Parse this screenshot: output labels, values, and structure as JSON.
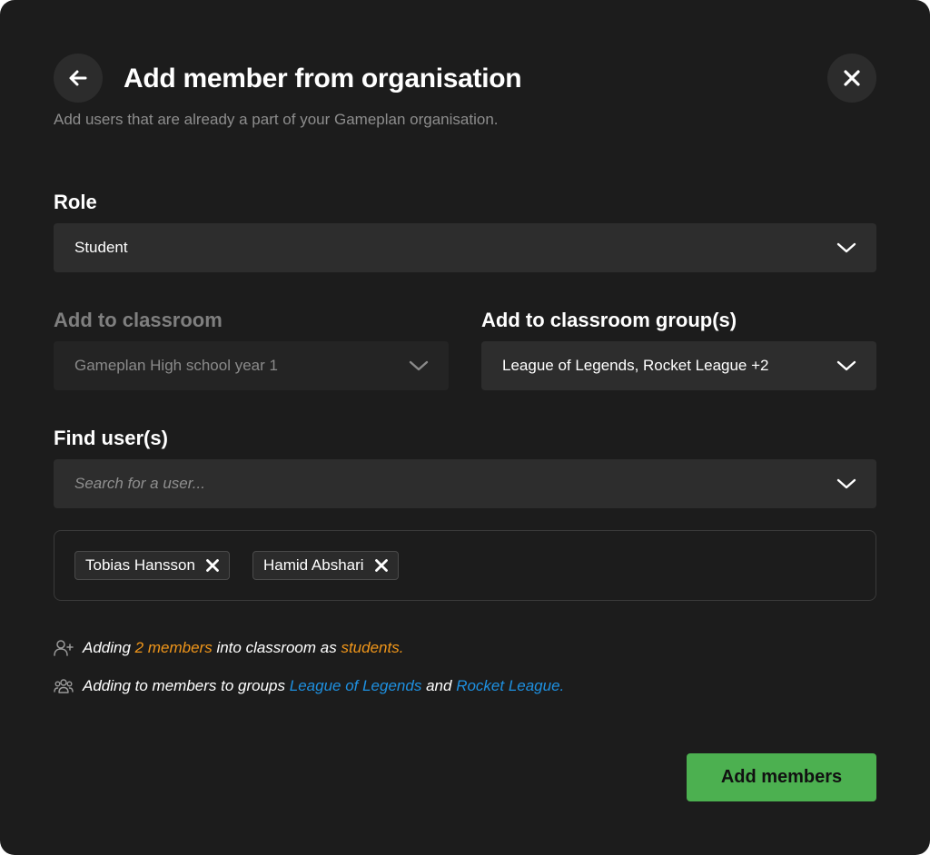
{
  "header": {
    "title": "Add member from organisation",
    "subtitle": "Add users that are already a part of your Gameplan organisation."
  },
  "role": {
    "label": "Role",
    "value": "Student"
  },
  "classroom": {
    "label": "Add to classroom",
    "value": "Gameplan High school year 1"
  },
  "groups": {
    "label": "Add to classroom group(s)",
    "value": "League of Legends, Rocket League +2"
  },
  "find_users": {
    "label": "Find user(s)",
    "placeholder": "Search for a user..."
  },
  "selected_users": [
    "Tobias Hansson",
    "Hamid Abshari"
  ],
  "summary": {
    "line1": {
      "prefix": "Adding",
      "count": "2 members",
      "middle": "into classroom as",
      "role": "students."
    },
    "line2": {
      "prefix": "Adding to members to groups",
      "group1": "League of Legends",
      "and": "and",
      "group2": "Rocket League."
    }
  },
  "actions": {
    "submit_label": "Add members"
  },
  "colors": {
    "background": "#1c1c1c",
    "field": "#2d2d2d",
    "accent_green": "#4cb050",
    "highlight_orange": "#f0961a",
    "link_blue": "#1e90e0"
  },
  "icons": {
    "back": "arrow-left-icon",
    "close": "close-icon",
    "chevron": "chevron-down-icon",
    "remove": "x-icon",
    "add_user": "user-plus-icon",
    "group": "users-group-icon"
  }
}
